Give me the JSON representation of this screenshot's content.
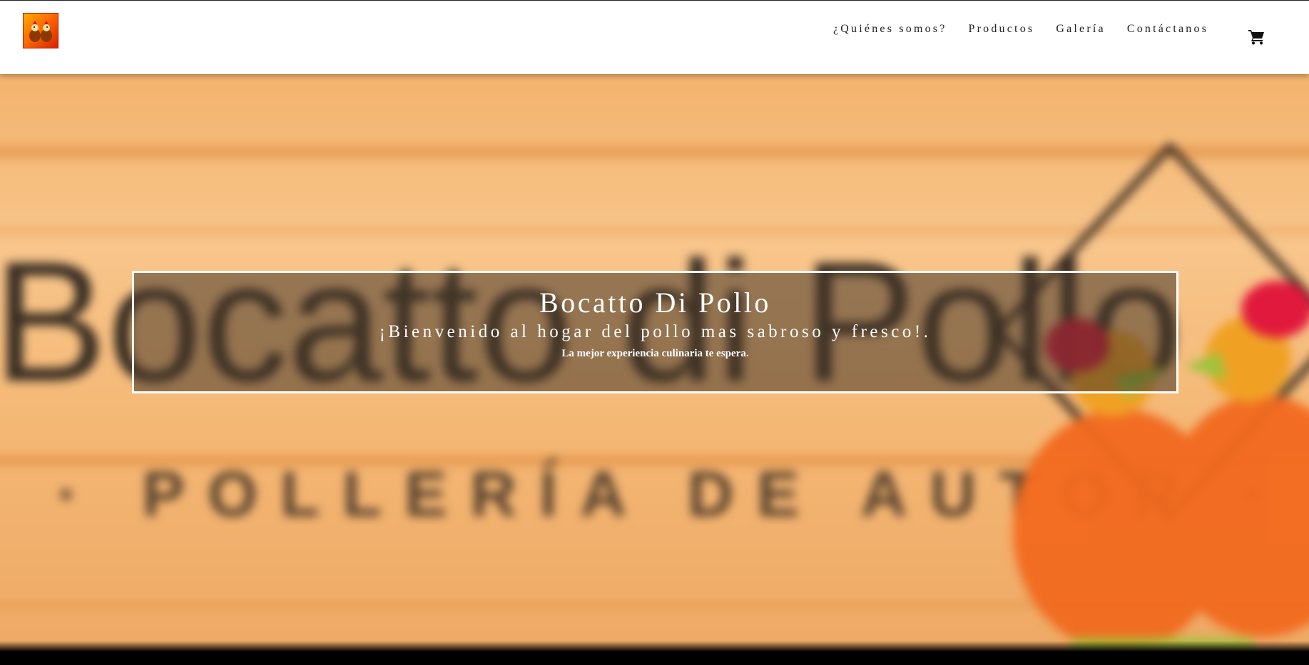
{
  "navbar": {
    "logo_icon": "chicken-logo-icon",
    "links": [
      {
        "label": "¿Quiénes somos?"
      },
      {
        "label": "Productos"
      },
      {
        "label": "Galería"
      },
      {
        "label": "Contáctanos"
      }
    ],
    "cart_icon": "shopping-cart-icon"
  },
  "hero": {
    "background_sign_text": "Bocatto di Pollo",
    "background_sign_subtext": "· POLLERÍA DE AUTOR ·",
    "banner": {
      "title": "Bocatto Di Pollo",
      "subtitle": "¡Bienvenido al hogar del pollo mas sabroso y fresco!.",
      "tagline": "La mejor experiencia culinaria te espera."
    }
  },
  "colors": {
    "wood": "#f5b676",
    "sign_ink": "#1e1a17",
    "chicken_orange": "#f26a1f",
    "comb_red": "#e0123a",
    "beak_green": "#9bc43a",
    "banner_border": "#ffffff"
  }
}
